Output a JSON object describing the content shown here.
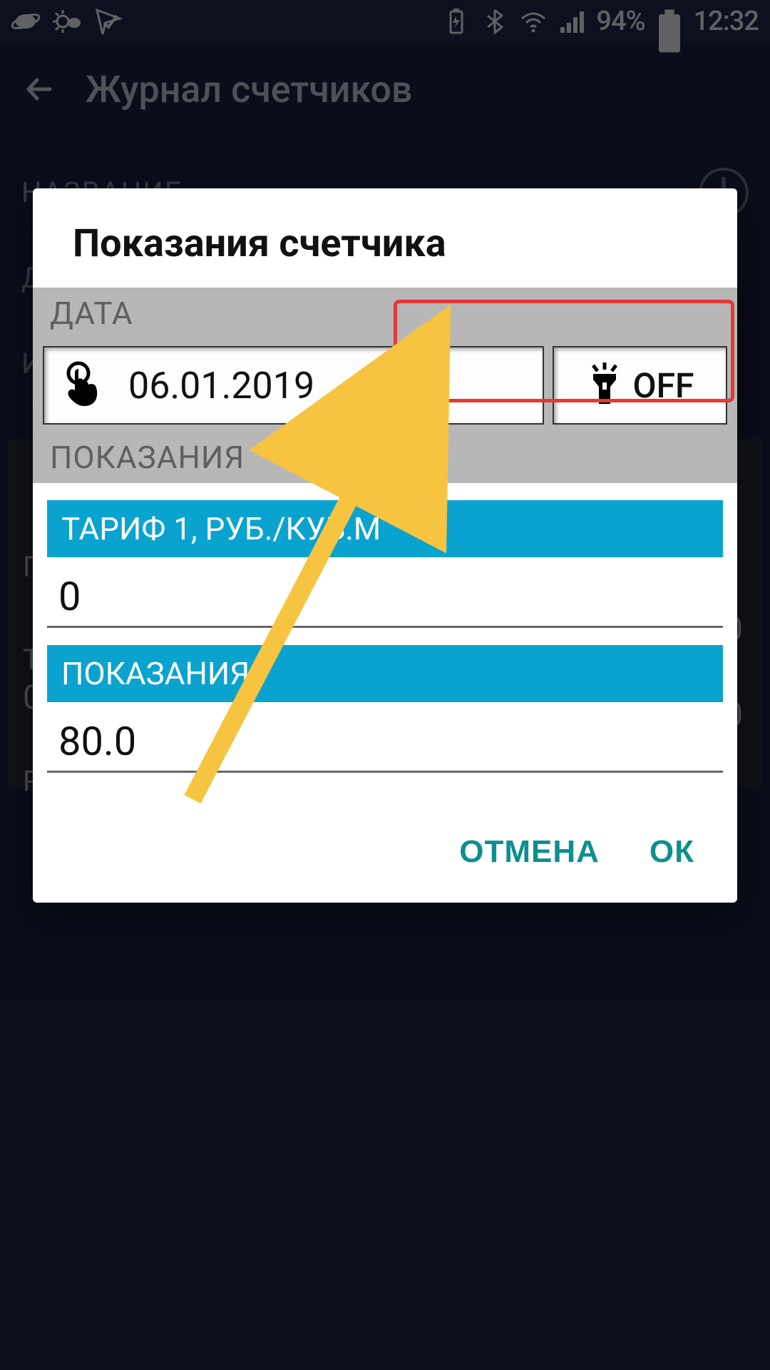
{
  "status_bar": {
    "battery_pct": "94%",
    "clock": "12:32"
  },
  "header": {
    "title": "Журнал счетчиков"
  },
  "background": {
    "name_label": "НАЗВАНИЕ",
    "partial_d": "Д",
    "partial_i": "И",
    "partial_p": "П",
    "partial_t": "Т",
    "partial_zero": "0",
    "partial_r": "Р"
  },
  "dialog": {
    "title": "Показания счетчика",
    "date_label": "ДАТА",
    "date_value": "06.01.2019",
    "torch_state": "OFF",
    "readings_label": "ПОКАЗАНИЯ",
    "tariff_label": "ТАРИФ 1, РУБ./КУБ.М",
    "tariff_value": "0",
    "reading_label": "ПОКАЗАНИЯ",
    "reading_value": "80.0",
    "cancel": "ОТМЕНА",
    "ok": "ОК"
  }
}
